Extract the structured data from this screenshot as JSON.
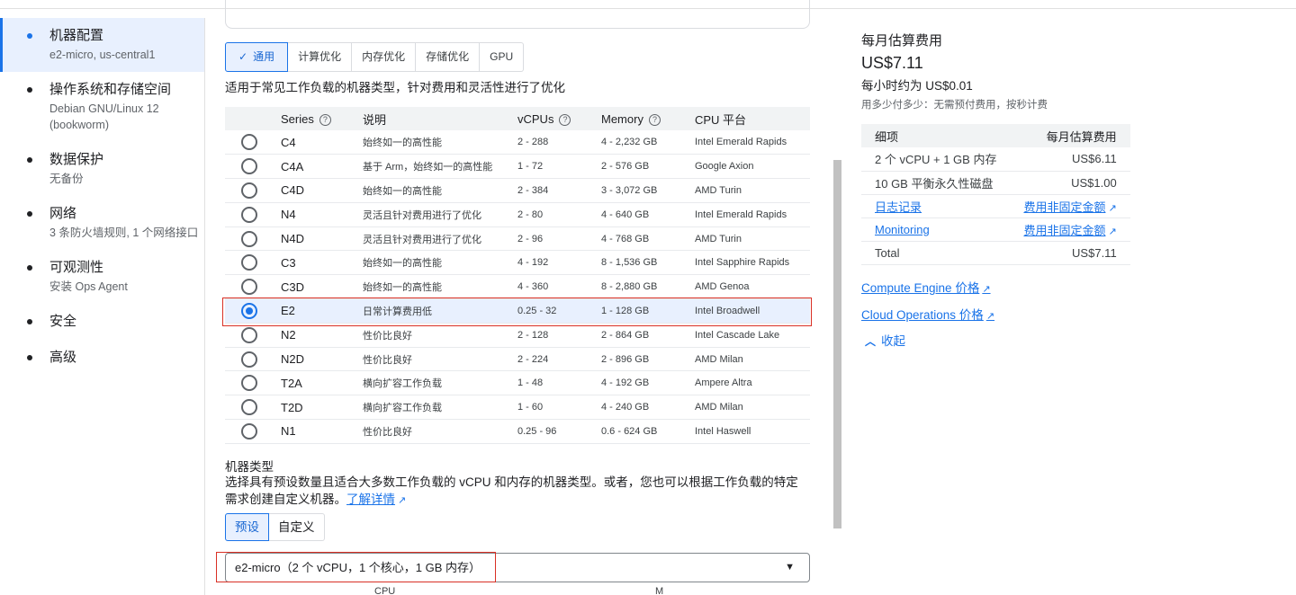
{
  "sidebar": {
    "items": [
      {
        "title": "机器配置",
        "sub": "e2-micro, us-central1",
        "active": true
      },
      {
        "title": "操作系统和存储空间",
        "sub": "Debian GNU/Linux 12 (bookworm)",
        "active": false
      },
      {
        "title": "数据保护",
        "sub": "无备份",
        "active": false
      },
      {
        "title": "网络",
        "sub": "3 条防火墙规则, 1 个网络接口",
        "active": false
      },
      {
        "title": "可观测性",
        "sub": "安装 Ops Agent",
        "active": false
      },
      {
        "title": "安全",
        "sub": "",
        "active": false
      },
      {
        "title": "高级",
        "sub": "",
        "active": false
      }
    ]
  },
  "tabs": [
    {
      "label": "通用",
      "active": true
    },
    {
      "label": "计算优化",
      "active": false
    },
    {
      "label": "内存优化",
      "active": false
    },
    {
      "label": "存储优化",
      "active": false
    },
    {
      "label": "GPU",
      "active": false
    }
  ],
  "tab_description": "适用于常见工作负载的机器类型，针对费用和灵活性进行了优化",
  "series_table": {
    "headers": {
      "series": "Series",
      "desc": "说明",
      "vcpus": "vCPUs",
      "memory": "Memory",
      "platform": "CPU 平台"
    },
    "rows": [
      {
        "series": "C4",
        "desc": "始终如一的高性能",
        "vcpus": "2 - 288",
        "memory": "4 - 2,232 GB",
        "platform": "Intel Emerald Rapids",
        "selected": false
      },
      {
        "series": "C4A",
        "desc": "基于 Arm，始终如一的高性能",
        "vcpus": "1 - 72",
        "memory": "2 - 576 GB",
        "platform": "Google Axion",
        "selected": false
      },
      {
        "series": "C4D",
        "desc": "始终如一的高性能",
        "vcpus": "2 - 384",
        "memory": "3 - 3,072 GB",
        "platform": "AMD Turin",
        "selected": false
      },
      {
        "series": "N4",
        "desc": "灵活且针对费用进行了优化",
        "vcpus": "2 - 80",
        "memory": "4 - 640 GB",
        "platform": "Intel Emerald Rapids",
        "selected": false
      },
      {
        "series": "N4D",
        "desc": "灵活且针对费用进行了优化",
        "vcpus": "2 - 96",
        "memory": "4 - 768 GB",
        "platform": "AMD Turin",
        "selected": false
      },
      {
        "series": "C3",
        "desc": "始终如一的高性能",
        "vcpus": "4 - 192",
        "memory": "8 - 1,536 GB",
        "platform": "Intel Sapphire Rapids",
        "selected": false
      },
      {
        "series": "C3D",
        "desc": "始终如一的高性能",
        "vcpus": "4 - 360",
        "memory": "8 - 2,880 GB",
        "platform": "AMD Genoa",
        "selected": false
      },
      {
        "series": "E2",
        "desc": "日常计算费用低",
        "vcpus": "0.25 - 32",
        "memory": "1 - 128 GB",
        "platform": "Intel Broadwell",
        "selected": true
      },
      {
        "series": "N2",
        "desc": "性价比良好",
        "vcpus": "2 - 128",
        "memory": "2 - 864 GB",
        "platform": "Intel Cascade Lake",
        "selected": false
      },
      {
        "series": "N2D",
        "desc": "性价比良好",
        "vcpus": "2 - 224",
        "memory": "2 - 896 GB",
        "platform": "AMD Milan",
        "selected": false
      },
      {
        "series": "T2A",
        "desc": "横向扩容工作负载",
        "vcpus": "1 - 48",
        "memory": "4 - 192 GB",
        "platform": "Ampere Altra",
        "selected": false
      },
      {
        "series": "T2D",
        "desc": "横向扩容工作负载",
        "vcpus": "1 - 60",
        "memory": "4 - 240 GB",
        "platform": "AMD Milan",
        "selected": false
      },
      {
        "series": "N1",
        "desc": "性价比良好",
        "vcpus": "0.25 - 96",
        "memory": "0.6 - 624 GB",
        "platform": "Intel Haswell",
        "selected": false
      }
    ]
  },
  "machine_type": {
    "title": "机器类型",
    "description": "选择具有预设数量且适合大多数工作负载的 vCPU 和内存的机器类型。或者，您也可以根据工作负载的特定需求创建自定义机器。",
    "learn_more": "了解详情",
    "toggle": {
      "preset": "预设",
      "custom": "自定义"
    },
    "selected_value": "e2-micro（2 个 vCPU，1 个核心，1 GB 内存）",
    "peek_left": "CPU",
    "peek_right": "M"
  },
  "cost": {
    "title": "每月估算费用",
    "price": "US$7.11",
    "hourly": "每小时约为 US$0.01",
    "note": "用多少付多少：无需预付费用，按秒计费",
    "table": {
      "header_item": "细项",
      "header_cost": "每月估算费用",
      "rows": [
        {
          "item": "2 个 vCPU + 1 GB 内存",
          "cost": "US$6.11",
          "link": false
        },
        {
          "item": "10 GB 平衡永久性磁盘",
          "cost": "US$1.00",
          "link": false
        },
        {
          "item": "日志记录",
          "cost": "费用非固定金额",
          "link": true
        },
        {
          "item": "Monitoring",
          "cost": "费用非固定金额",
          "link": true
        }
      ],
      "total_label": "Total",
      "total_value": "US$7.11"
    },
    "links": {
      "compute_engine": "Compute Engine 价格",
      "cloud_operations": "Cloud Operations 价格"
    },
    "collapse": "收起"
  },
  "colors": {
    "accent": "#1a73e8",
    "highlight_outline": "#d93025",
    "selected_bg": "#e8f0fe"
  },
  "icons": [
    "check-icon",
    "help-icon",
    "external-link-icon",
    "dropdown-arrow-icon",
    "chevron-up-icon"
  ]
}
